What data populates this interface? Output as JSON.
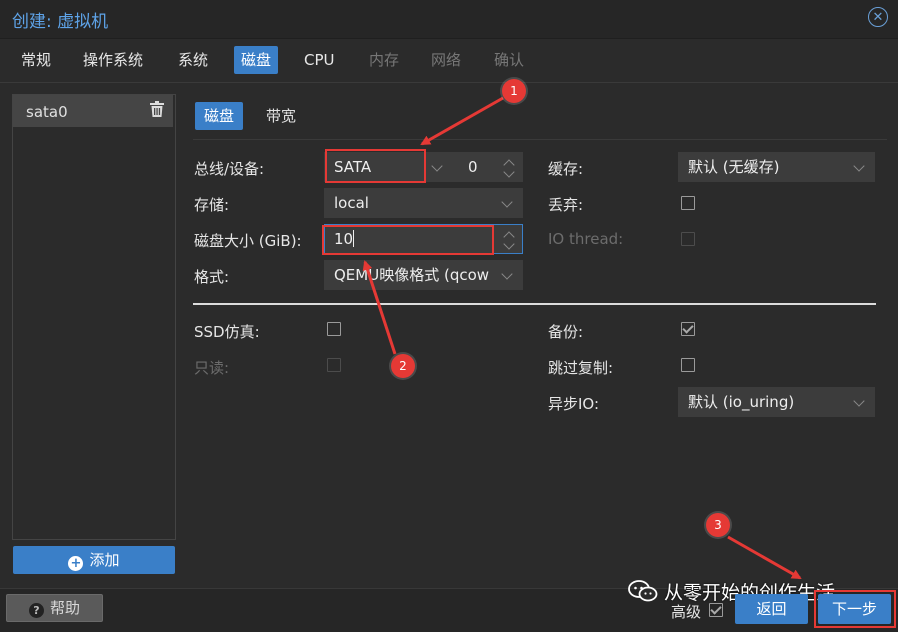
{
  "window": {
    "title": "创建: 虚拟机"
  },
  "tabs": [
    {
      "label": "常规"
    },
    {
      "label": "操作系统"
    },
    {
      "label": "系统"
    },
    {
      "label": "磁盘"
    },
    {
      "label": "CPU"
    },
    {
      "label": "内存"
    },
    {
      "label": "网络"
    },
    {
      "label": "确认"
    }
  ],
  "disk_list": {
    "items": [
      {
        "label": "sata0"
      }
    ],
    "add_label": "添加"
  },
  "inner_tabs": [
    {
      "label": "磁盘"
    },
    {
      "label": "带宽"
    }
  ],
  "form": {
    "bus_label": "总线/设备:",
    "bus_value": "SATA",
    "device_index": "0",
    "storage_label": "存储:",
    "storage_value": "local",
    "size_label": "磁盘大小 (GiB):",
    "size_value": "10",
    "format_label": "格式:",
    "format_value": "QEMU映像格式 (qcow",
    "cache_label": "缓存:",
    "cache_value": "默认 (无缓存)",
    "discard_label": "丢弃:",
    "discard_checked": false,
    "iothread_label": "IO thread:",
    "iothread_checked": false,
    "ssd_label": "SSD仿真:",
    "ssd_checked": false,
    "readonly_label": "只读:",
    "readonly_checked": false,
    "backup_label": "备份:",
    "backup_checked": true,
    "skip_replication_label": "跳过复制:",
    "skip_replication_checked": false,
    "async_io_label": "异步IO:",
    "async_io_value": "默认 (io_uring)"
  },
  "annotations": [
    {
      "number": "1"
    },
    {
      "number": "2"
    },
    {
      "number": "3"
    }
  ],
  "footer": {
    "help_label": "帮助",
    "advanced_label": "高级",
    "advanced_checked": true,
    "back_label": "返回",
    "next_label": "下一步"
  },
  "watermark": {
    "text": "从零开始的创作生活"
  },
  "colors": {
    "accent": "#3a7fc8",
    "highlight": "#e53935",
    "background": "#2b2b2b"
  }
}
